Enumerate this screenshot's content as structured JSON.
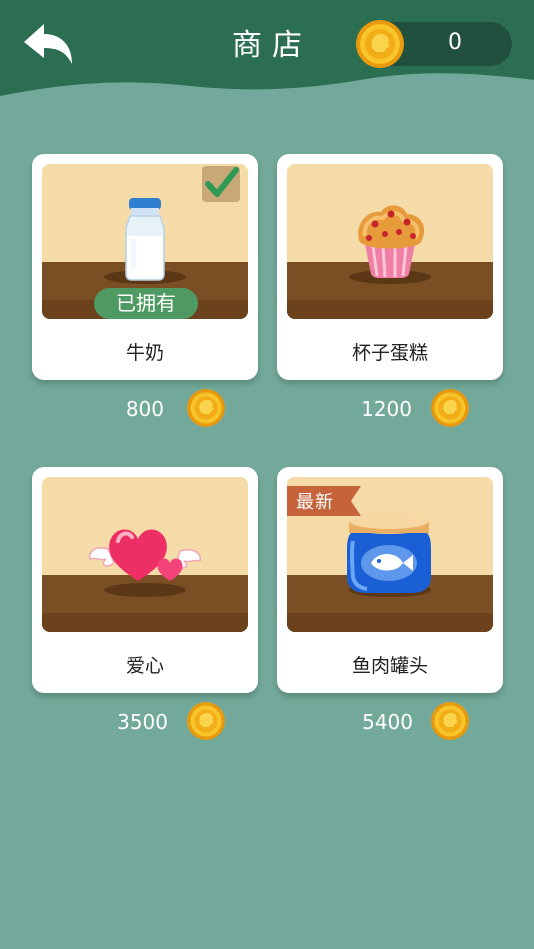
{
  "header": {
    "title": "商店",
    "coins": "0"
  },
  "colors": {
    "background": "#72a99a",
    "header": "#2b6e52",
    "coin_pill": "#22503f",
    "owned_badge": "#4f9a63",
    "new_ribbon": "#c6633a",
    "coin_gold": "#f5b81c"
  },
  "items": [
    {
      "name": "牛奶",
      "price": "800",
      "badge": "已拥有",
      "owned": true,
      "icon": "milk-bottle-icon"
    },
    {
      "name": "杯子蛋糕",
      "price": "1200",
      "icon": "cupcake-icon"
    },
    {
      "name": "爱心",
      "price": "3500",
      "icon": "winged-hearts-icon"
    },
    {
      "name": "鱼肉罐头",
      "price": "5400",
      "ribbon": "最新",
      "icon": "fish-can-icon"
    }
  ]
}
